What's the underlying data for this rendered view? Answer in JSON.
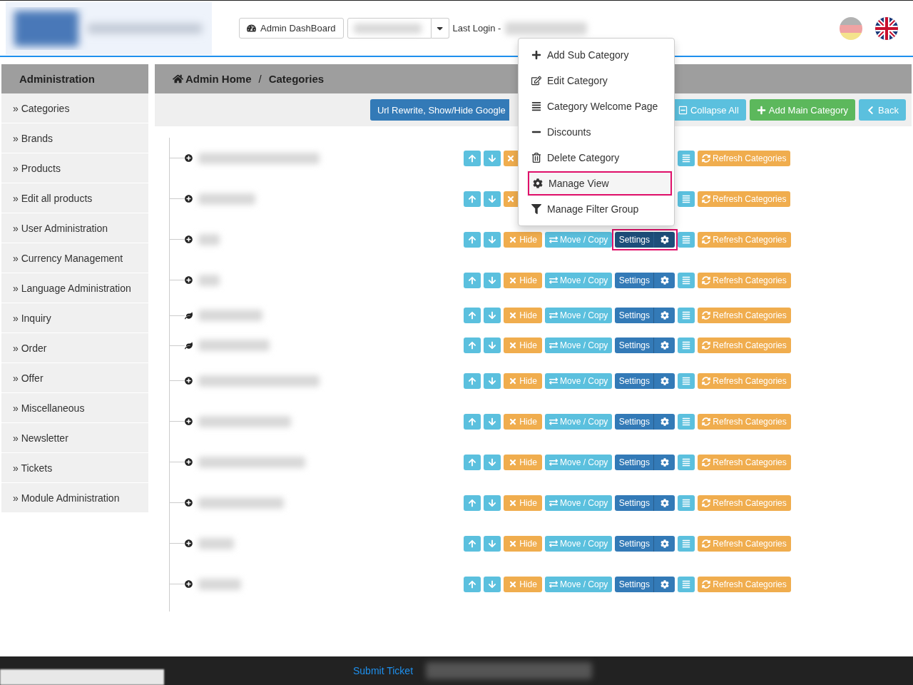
{
  "header": {
    "dashboard_button": "Admin DashBoard",
    "last_login_label": "Last Login -"
  },
  "sidebar": {
    "title": "Administration",
    "items": [
      {
        "label": "» Categories"
      },
      {
        "label": "» Brands"
      },
      {
        "label": "» Products"
      },
      {
        "label": "» Edit all products"
      },
      {
        "label": "» User Administration"
      },
      {
        "label": "» Currency Management"
      },
      {
        "label": "» Language Administration"
      },
      {
        "label": "» Inquiry"
      },
      {
        "label": "» Order"
      },
      {
        "label": "» Offer"
      },
      {
        "label": "» Miscellaneous"
      },
      {
        "label": "» Newsletter"
      },
      {
        "label": "» Tickets"
      },
      {
        "label": "» Module Administration"
      }
    ]
  },
  "breadcrumb": {
    "separator": "/",
    "items": [
      {
        "kind": "home",
        "label": "Admin Home"
      },
      {
        "kind": "current",
        "label": "Categories"
      }
    ]
  },
  "toolbar": {
    "buttons": [
      {
        "kind": "url",
        "label": "Url Rewrite, Show/Hide Google"
      },
      {
        "kind": "collapse",
        "label": "Collapse All"
      },
      {
        "kind": "add",
        "label": "Add Main Category"
      },
      {
        "kind": "back",
        "label": "Back"
      }
    ]
  },
  "context_menu": {
    "items": [
      {
        "kind": "add",
        "label": "Add Sub Category",
        "selected": false
      },
      {
        "kind": "edit",
        "label": "Edit Category",
        "selected": false
      },
      {
        "kind": "page",
        "label": "Category Welcome Page",
        "selected": false
      },
      {
        "kind": "discount",
        "label": "Discounts",
        "selected": false
      },
      {
        "kind": "delete",
        "label": "Delete Category",
        "selected": false
      },
      {
        "kind": "view",
        "label": "Manage View",
        "selected": true
      },
      {
        "kind": "filter",
        "label": "Manage Filter Group",
        "selected": false
      }
    ]
  },
  "tree": {
    "rows": [
      {
        "kind": "branch",
        "refresh": "Refresh Categories"
      },
      {
        "kind": "branch",
        "refresh": "Refresh Categories"
      },
      {
        "kind": "branch",
        "hide": "Hide",
        "move": "Move / Copy",
        "settings": "Settings",
        "refresh": "Refresh Categories",
        "selected": true
      },
      {
        "kind": "branch",
        "hide": "Hide",
        "move": "Move / Copy",
        "settings": "Settings",
        "refresh": "Refresh Categories",
        "selected": false
      },
      {
        "kind": "leaf",
        "hide": "Hide",
        "move": "Move / Copy",
        "settings": "Settings",
        "refresh": "Refresh Categories",
        "selected": false
      },
      {
        "kind": "leaf",
        "hide": "Hide",
        "move": "Move / Copy",
        "settings": "Settings",
        "refresh": "Refresh Categories",
        "selected": false
      },
      {
        "kind": "branch",
        "hide": "Hide",
        "move": "Move / Copy",
        "settings": "Settings",
        "refresh": "Refresh Categories",
        "selected": false
      },
      {
        "kind": "branch",
        "hide": "Hide",
        "move": "Move / Copy",
        "settings": "Settings",
        "refresh": "Refresh Categories",
        "selected": false
      },
      {
        "kind": "branch",
        "hide": "Hide",
        "move": "Move / Copy",
        "settings": "Settings",
        "refresh": "Refresh Categories",
        "selected": false
      },
      {
        "kind": "branch",
        "hide": "Hide",
        "move": "Move / Copy",
        "settings": "Settings",
        "refresh": "Refresh Categories",
        "selected": false
      },
      {
        "kind": "branch",
        "hide": "Hide",
        "move": "Move / Copy",
        "settings": "Settings",
        "refresh": "Refresh Categories",
        "selected": false
      },
      {
        "kind": "branch",
        "hide": "Hide",
        "move": "Move / Copy",
        "settings": "Settings",
        "refresh": "Refresh Categories",
        "selected": false
      }
    ]
  },
  "footer": {
    "link": "Submit Ticket"
  }
}
